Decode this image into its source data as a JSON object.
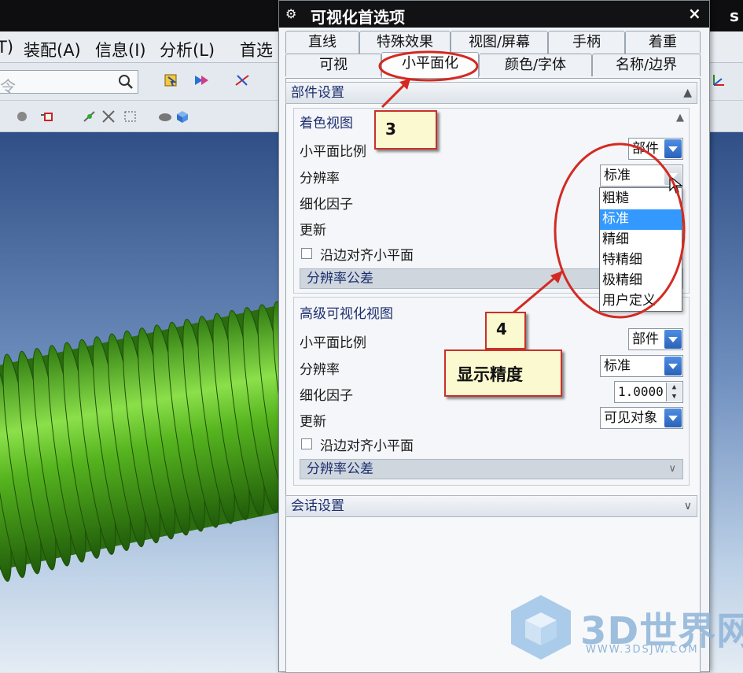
{
  "app": {
    "menu": [
      "T)",
      "装配(A)",
      "信息(I)",
      "分析(L)",
      "首选"
    ],
    "command_search_placeholder": "令",
    "topbar_edge_text": "s"
  },
  "dialog": {
    "title": "可视化首选项",
    "close_label": "×",
    "tabs_row1": [
      "直线",
      "特殊效果",
      "视图/屏幕",
      "手柄",
      "着重"
    ],
    "tabs_row2": [
      "可视",
      "小平面化",
      "颜色/字体",
      "名称/边界"
    ],
    "active_tab": "小平面化",
    "part_settings": {
      "header": "部件设置",
      "shaded_view": {
        "title": "着色视图",
        "facet_ratio_label": "小平面比例",
        "facet_ratio_value": "部件",
        "resolution_label": "分辨率",
        "resolution_value": "标准",
        "refine_label": "细化因子",
        "update_label": "更新",
        "align_checkbox_label": "沿边对齐小平面",
        "tolerance_bar": "分辨率公差"
      },
      "advanced_view": {
        "title": "高级可视化视图",
        "facet_ratio_label": "小平面比例",
        "facet_ratio_value": "部件",
        "resolution_label": "分辨率",
        "resolution_value": "标准",
        "refine_label": "细化因子",
        "refine_value": "1.0000",
        "update_label": "更新",
        "update_value": "可见对象",
        "align_checkbox_label": "沿边对齐小平面",
        "tolerance_bar": "分辨率公差"
      }
    },
    "session_settings": {
      "header": "会话设置"
    },
    "resolution_options": [
      "粗糙",
      "标准",
      "精细",
      "特精细",
      "极精细",
      "用户定义"
    ],
    "resolution_selected": "标准"
  },
  "annotations": {
    "callout_3": "3",
    "callout_4": "4",
    "callout_4_text": "显示精度",
    "annotation_color": "#d32a22"
  },
  "watermark": {
    "text": "3D世界网",
    "url": "WWW.3DSJW.COM"
  }
}
